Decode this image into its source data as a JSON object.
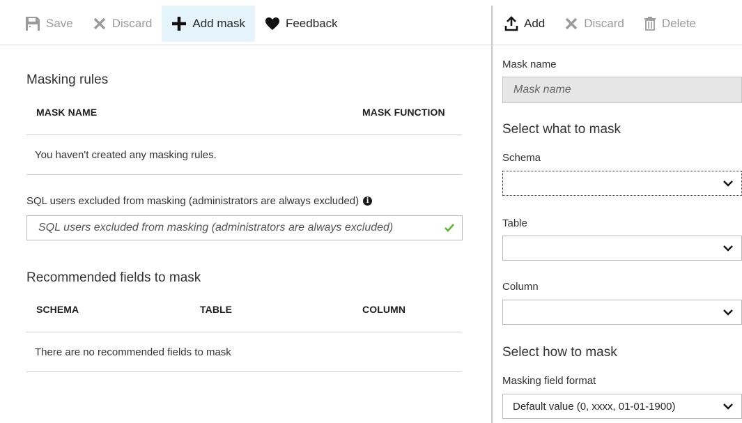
{
  "left": {
    "toolbar": {
      "save": "Save",
      "discard": "Discard",
      "add_mask": "Add mask",
      "feedback": "Feedback"
    },
    "masking_rules": {
      "title": "Masking rules",
      "col_mask_name": "MASK NAME",
      "col_mask_function": "MASK FUNCTION",
      "empty": "You haven't created any masking rules."
    },
    "excluded_users": {
      "label": "SQL users excluded from masking (administrators are always excluded)",
      "placeholder": "SQL users excluded from masking (administrators are always excluded)"
    },
    "recommended": {
      "title": "Recommended fields to mask",
      "col_schema": "SCHEMA",
      "col_table": "TABLE",
      "col_column": "COLUMN",
      "empty": "There are no recommended fields to mask"
    }
  },
  "right": {
    "toolbar": {
      "add": "Add",
      "discard": "Discard",
      "delete": "Delete"
    },
    "mask_name": {
      "label": "Mask name",
      "placeholder": "Mask name"
    },
    "select_what": "Select what to mask",
    "schema": {
      "label": "Schema",
      "value": ""
    },
    "table": {
      "label": "Table",
      "value": ""
    },
    "column": {
      "label": "Column",
      "value": ""
    },
    "select_how": "Select how to mask",
    "format": {
      "label": "Masking field format",
      "value": "Default value (0, xxxx, 01-01-1900)"
    }
  },
  "colors": {
    "active_bg": "#e5f3fb",
    "disabled_text": "#9b9b9b",
    "check_green": "#5bb530"
  }
}
